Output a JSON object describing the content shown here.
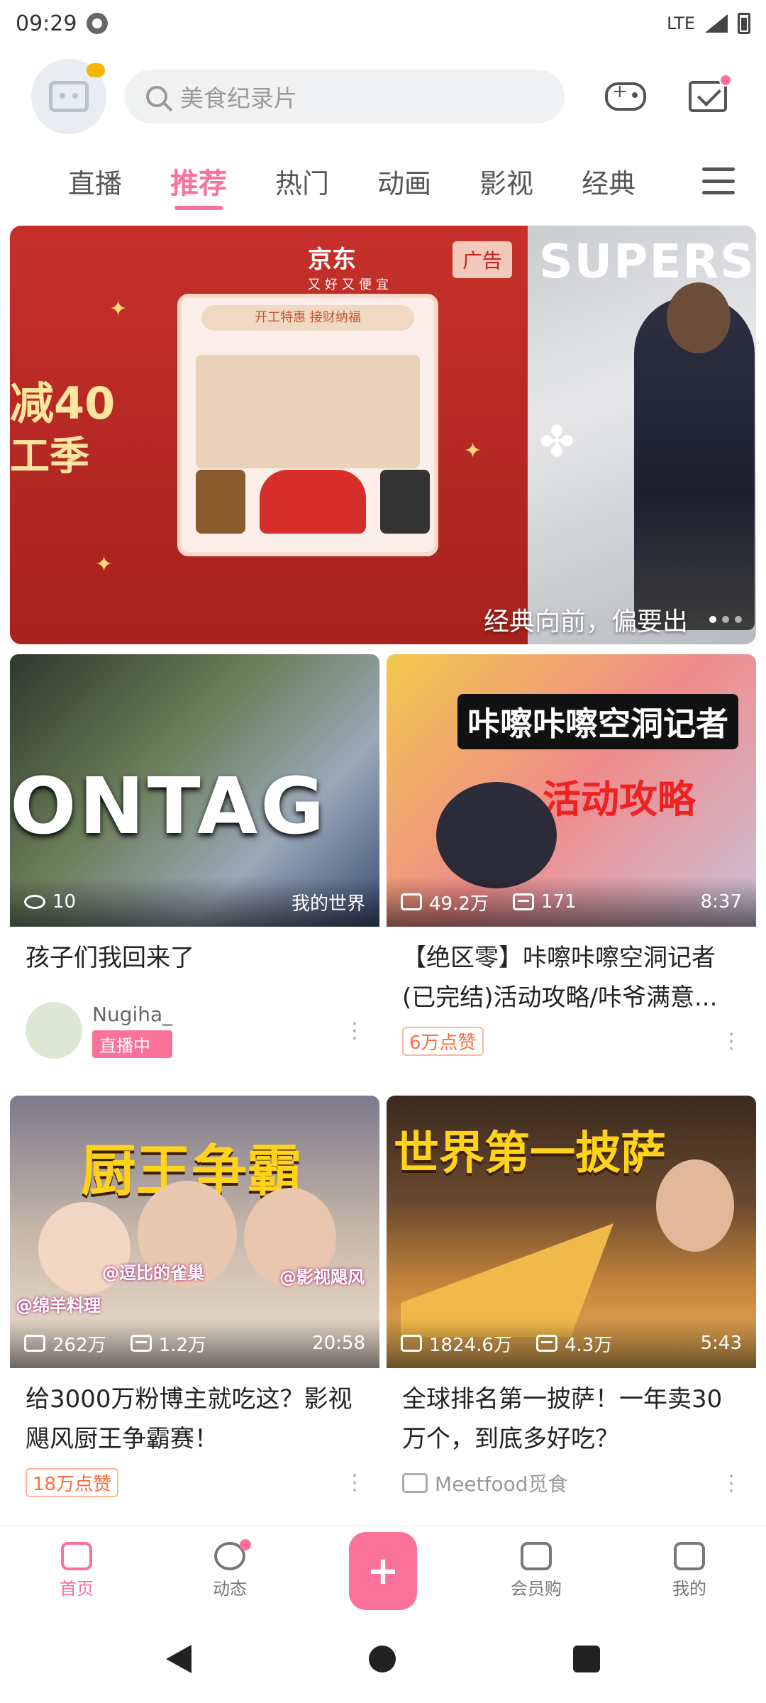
{
  "status": {
    "time": "09:29",
    "network": "LTE"
  },
  "header": {
    "search_placeholder": "美食纪录片"
  },
  "tabs": [
    "直播",
    "推荐",
    "热门",
    "动画",
    "影视",
    "经典"
  ],
  "banner": {
    "ad_brand": "京东",
    "ad_slogan": "又好又便宜",
    "ad_tag": "广告",
    "ad_strip": "开工特惠 接财纳福",
    "ad_left_line1": "减40",
    "ad_left_line2": "工季",
    "photo_brand": "SUPERSTAR",
    "caption": "经典向前，偏要出"
  },
  "cards": [
    {
      "stat1": "10",
      "duration": "我的世界",
      "title": "孩子们我回来了",
      "up_name": "Nugiha_",
      "live_label": "直播中"
    },
    {
      "stat1": "49.2万",
      "stat2": "171",
      "duration": "8:37",
      "thumb_title": "咔嚓咔嚓空洞记者",
      "thumb_sub": "活动攻略",
      "title": "【绝区零】咔嚓咔嚓空洞记者(已完结)活动攻略/咔爷满意...",
      "likes": "6万点赞"
    },
    {
      "stat1": "262万",
      "stat2": "1.2万",
      "duration": "20:58",
      "thumb_title": "厨王争霸",
      "tag1": "@逗比的雀巢",
      "tag2": "@影视飓风",
      "tag3": "@绵羊料理",
      "title": "给3000万粉博主就吃这？影视飓风厨王争霸赛！",
      "likes": "18万点赞"
    },
    {
      "stat1": "1824.6万",
      "stat2": "4.3万",
      "duration": "5:43",
      "thumb_title": "世界第一披萨",
      "title": "全球排名第一披萨！一年卖30万个，到底多好吃？",
      "up_name": "Meetfood觅食"
    }
  ],
  "bottom_nav": [
    "首页",
    "动态",
    "",
    "会员购",
    "我的"
  ],
  "colors": {
    "accent": "#fb7299",
    "likes": "#ff6a3c"
  }
}
